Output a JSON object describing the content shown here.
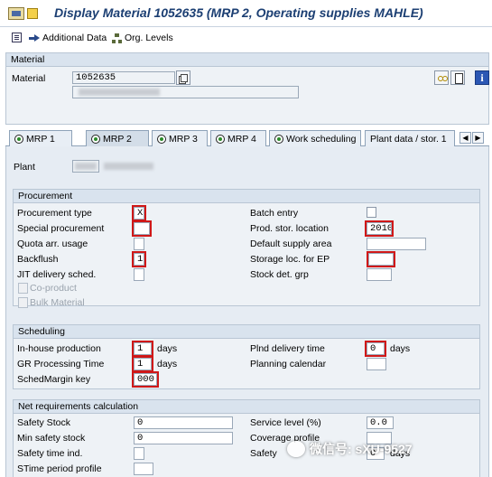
{
  "window": {
    "title": "Display Material 1052635 (MRP 2, Operating supplies MAHLE)",
    "app_icon": "sap-logo-icon",
    "flag_icon": "flag-icon"
  },
  "toolbar": {
    "items": [
      {
        "icon": "additional-data-icon",
        "label": ""
      },
      {
        "icon": "arrow-right-icon",
        "label": "Additional Data"
      },
      {
        "icon": "org-levels-icon",
        "label": "Org. Levels"
      }
    ]
  },
  "material_section": {
    "header": "Material",
    "material_label": "Material",
    "material_value": "1052635"
  },
  "tabs": [
    {
      "label": "MRP 1",
      "active": false
    },
    {
      "label": "MRP 2",
      "active": true
    },
    {
      "label": "MRP 3",
      "active": false
    },
    {
      "label": "MRP 4",
      "active": false
    },
    {
      "label": "Work scheduling",
      "active": false
    },
    {
      "label": "Plant data / stor. 1",
      "active": false
    }
  ],
  "plant": {
    "label": "Plant"
  },
  "procurement": {
    "header": "Procurement",
    "procurement_type": {
      "label": "Procurement type",
      "value": "X"
    },
    "special_procurement": {
      "label": "Special procurement",
      "value": ""
    },
    "quota_arr_usage": {
      "label": "Quota arr. usage",
      "value": ""
    },
    "backflush": {
      "label": "Backflush",
      "value": "1"
    },
    "jit_delivery": {
      "label": "JIT delivery sched.",
      "value": ""
    },
    "co_product": {
      "label": "Co-product"
    },
    "bulk_material": {
      "label": "Bulk Material"
    },
    "batch_entry": {
      "label": "Batch entry"
    },
    "prod_stor_location": {
      "label": "Prod. stor. location",
      "value": "2010"
    },
    "default_supply_area": {
      "label": "Default supply area",
      "value": ""
    },
    "storage_loc_ep": {
      "label": "Storage loc. for EP",
      "value": ""
    },
    "stock_det_grp": {
      "label": "Stock det. grp",
      "value": ""
    }
  },
  "scheduling": {
    "header": "Scheduling",
    "inhouse_production": {
      "label": "In-house production",
      "value": "1",
      "unit": "days"
    },
    "gr_processing_time": {
      "label": "GR Processing Time",
      "value": "1",
      "unit": "days"
    },
    "sched_margin_key": {
      "label": "SchedMargin key",
      "value": "000"
    },
    "plnd_delivery_time": {
      "label": "Plnd delivery time",
      "value": "0",
      "unit": "days"
    },
    "planning_calendar": {
      "label": "Planning calendar",
      "value": ""
    }
  },
  "net_requirements": {
    "header": "Net requirements calculation",
    "safety_stock": {
      "label": "Safety Stock",
      "value": "0"
    },
    "min_safety_stock": {
      "label": "Min safety stock",
      "value": "0"
    },
    "safety_time_ind": {
      "label": "Safety time ind.",
      "value": ""
    },
    "stime_period_profile": {
      "label": "STime period profile",
      "value": ""
    },
    "service_level": {
      "label": "Service level (%)",
      "value": "0.0"
    },
    "coverage_profile": {
      "label": "Coverage profile",
      "value": ""
    },
    "safety_time": {
      "label": "Safety",
      "value": "0",
      "unit": "days"
    }
  },
  "watermark": {
    "text": "微信号: sXU-9527"
  },
  "colors": {
    "title": "#1c3f73",
    "highlight": "#d01818",
    "section_bg": "#eef2f6",
    "section_header": "#d9e3ee"
  }
}
